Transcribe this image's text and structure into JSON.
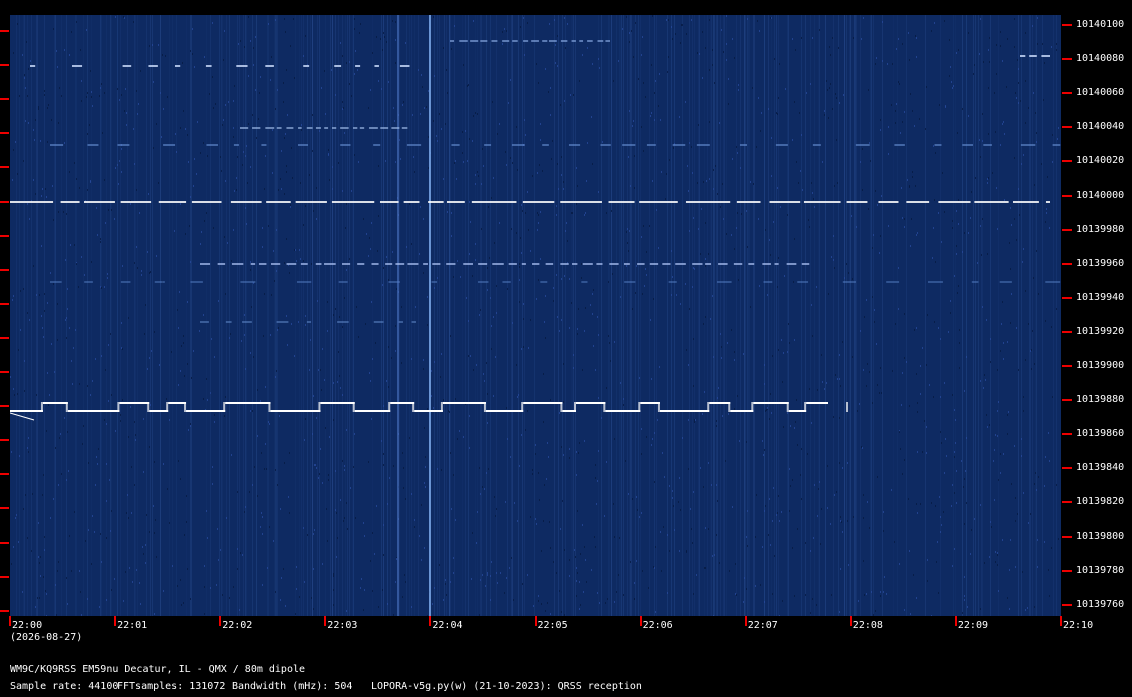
{
  "y_axis_labels": [
    "10140100",
    "10140080",
    "10140060",
    "10140040",
    "10140020",
    "10140000",
    "10139980",
    "10139960",
    "10139940",
    "10139920",
    "10139900",
    "10139880",
    "10139860",
    "10139840",
    "10139820",
    "10139800",
    "10139780",
    "10139760"
  ],
  "x_axis_labels": [
    "22:00",
    "22:01",
    "22:02",
    "22:03",
    "22:04",
    "22:05",
    "22:06",
    "22:07",
    "22:08",
    "22:09",
    "22:10"
  ],
  "date_label": "(2026-08-27)",
  "station_line": "WM9C/KQ9RSS EM59nu Decatur, IL - QMX / 80m dipole",
  "sample_rate": "Sample rate: 44100",
  "fft_samples": "FFTsamples: 131072",
  "bandwidth": "Bandwidth (mHz): 504",
  "software": "LOPORA-v5g.py(w) (21-10-2023): QRSS reception",
  "colors": {
    "background": "#0d2a63",
    "signal": "#ffffff",
    "tick": "#ee0000"
  }
}
